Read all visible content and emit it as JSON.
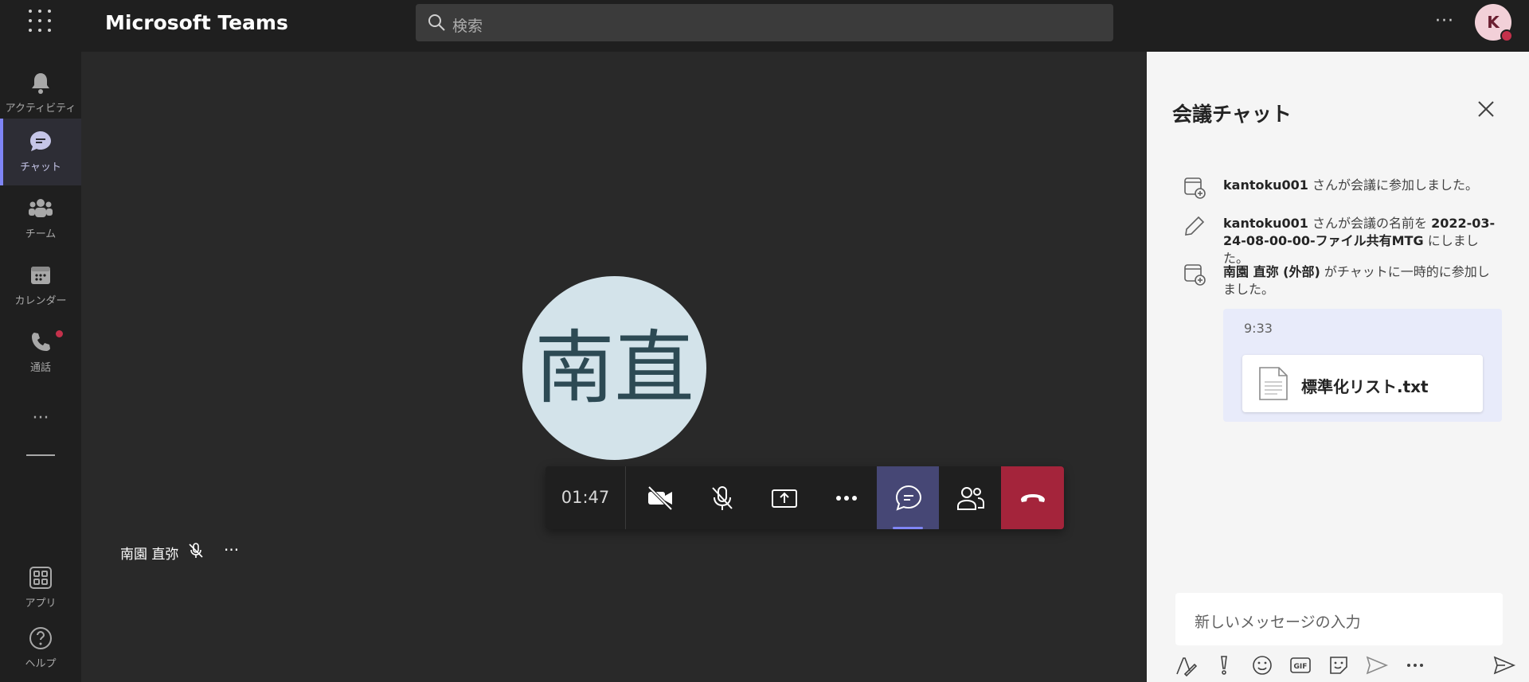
{
  "header": {
    "app_title": "Microsoft Teams",
    "search_placeholder": "検索",
    "more_label": "···",
    "avatar_initial": "K"
  },
  "rail": {
    "items": [
      {
        "label": "アクティビティ",
        "icon": "bell-icon"
      },
      {
        "label": "チャット",
        "icon": "chat-icon",
        "active": true
      },
      {
        "label": "チーム",
        "icon": "teams-icon"
      },
      {
        "label": "カレンダー",
        "icon": "calendar-icon"
      },
      {
        "label": "通話",
        "icon": "phone-icon"
      }
    ],
    "more_label": "···",
    "apps_label": "アプリ",
    "help_label": "ヘルプ"
  },
  "stage": {
    "avatar_text": "南直",
    "participant_name": "南園 直弥",
    "participant_more": "···"
  },
  "callbar": {
    "timer": "01:47"
  },
  "chat": {
    "title": "会議チャット",
    "events": [
      {
        "user": "kantoku001",
        "text": " さんが会議に参加しました。"
      },
      {
        "user": "kantoku001",
        "text_a": " さんが会議の名前を ",
        "meeting_name": "2022-03-24-08-00-00-ファイル共有MTG",
        "text_b": " にしました。"
      },
      {
        "user": "南園 直弥 (外部)",
        "text": " がチャットに一時的に参加しました。"
      }
    ],
    "message": {
      "time": "9:33",
      "file_name": "標準化リスト.txt"
    },
    "composer_placeholder": "新しいメッセージの入力"
  },
  "colors": {
    "accent": "#7f85f5",
    "hangup": "#a4243b",
    "chat_active": "#464775",
    "notification": "#c4314b"
  }
}
